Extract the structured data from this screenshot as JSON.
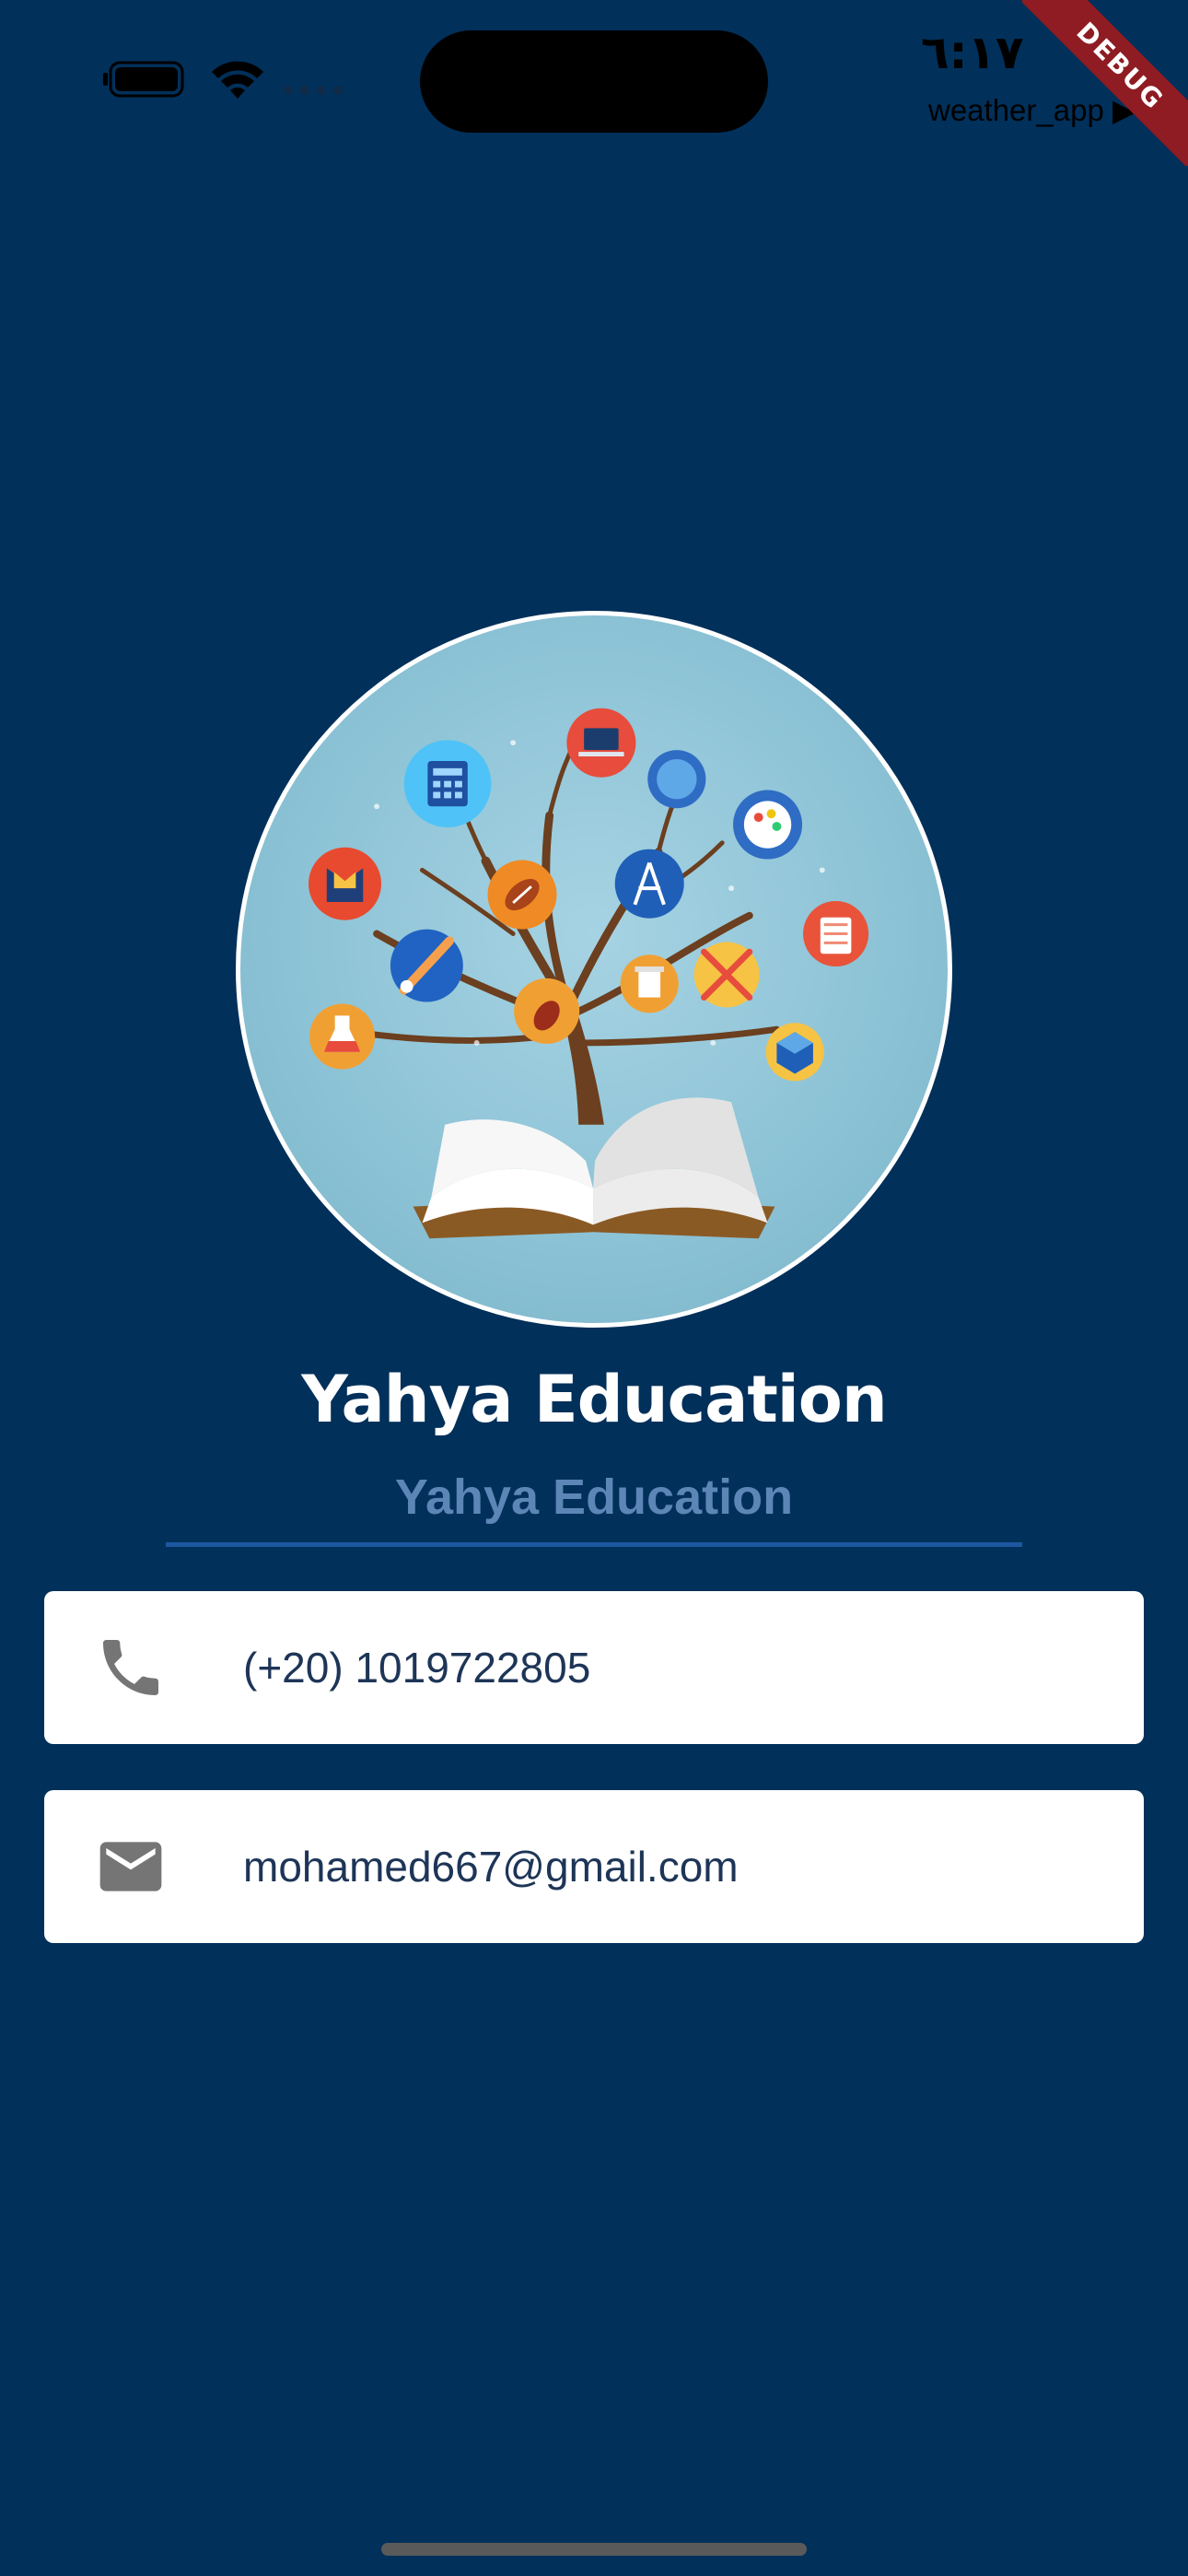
{
  "status_bar": {
    "time": "٦:١٧",
    "back_app_label": "weather_app ▶",
    "debug_label": "DEBUG"
  },
  "profile": {
    "avatar_icon": "education-tree-book-illustration",
    "name": "Yahya Education",
    "subtitle": "Yahya Education"
  },
  "contacts": [
    {
      "icon": "phone-icon",
      "text": "(+20) 1019722805"
    },
    {
      "icon": "mail-icon",
      "text": "mohamed667@gmail.com"
    }
  ],
  "colors": {
    "background": "#01305a",
    "subtitle": "#5c86b6",
    "divider": "#1b58a0",
    "card": "#ffffff",
    "card_text": "#1d3557",
    "icon": "#757575"
  }
}
